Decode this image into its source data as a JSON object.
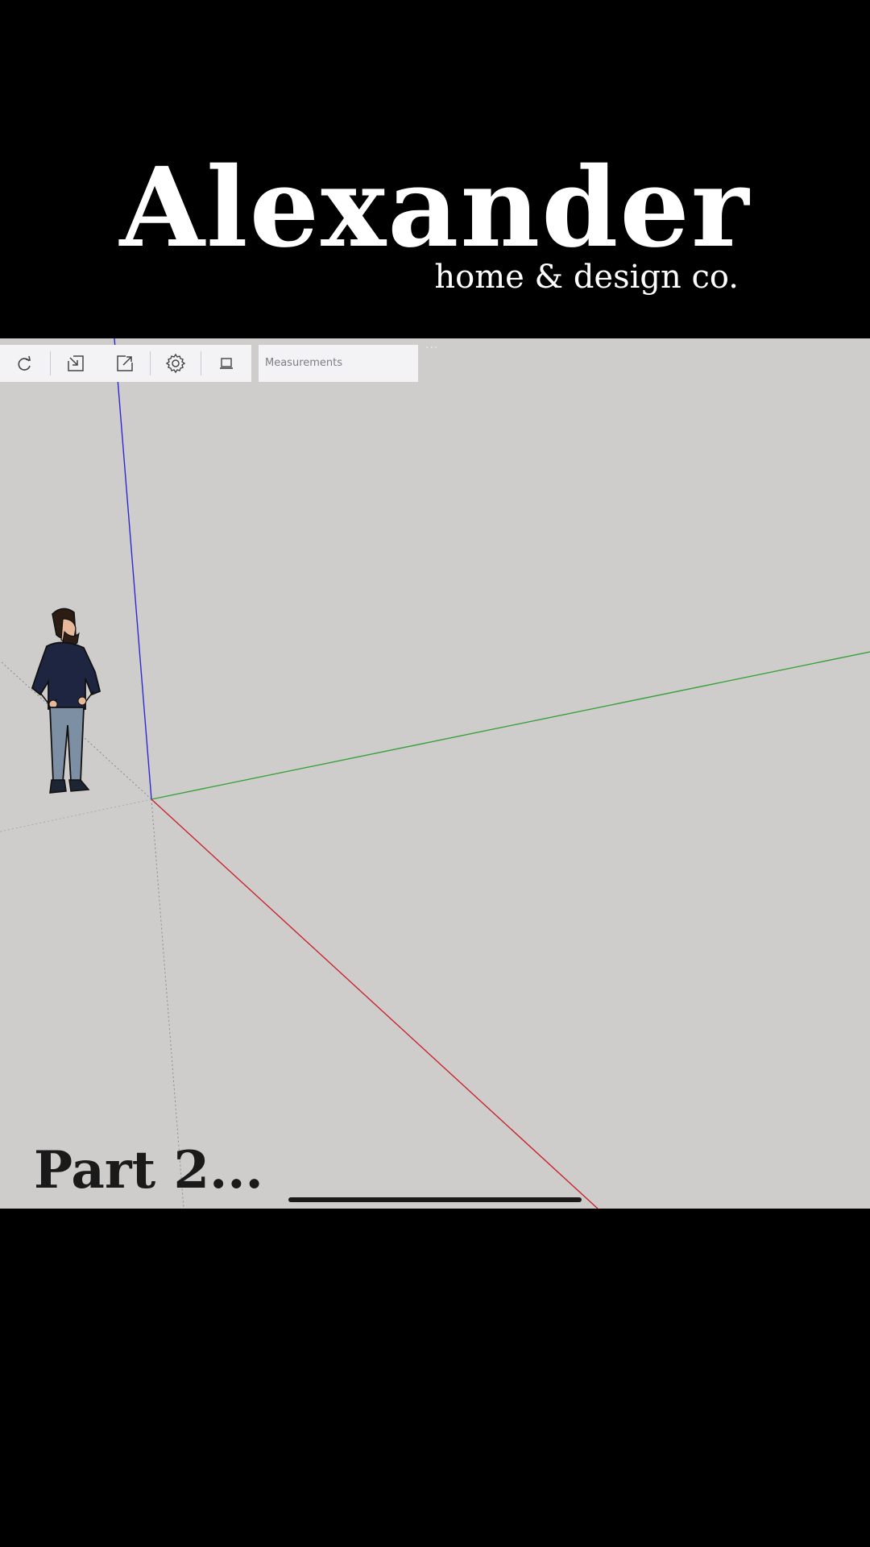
{
  "brand": {
    "name": "Alexander",
    "tagline": "home & design co."
  },
  "toolbar": {
    "icons": [
      "redo-icon",
      "import-icon",
      "export-icon",
      "settings-icon",
      "scene-icon"
    ],
    "measurements_label": "Measurements",
    "more_label": "..."
  },
  "viewport": {
    "background": "#cfcdcc",
    "axis_colors": {
      "red": "#c8262e",
      "green": "#3aa13a",
      "blue": "#2a2ad0"
    }
  },
  "caption": {
    "text": "Part 2..."
  }
}
